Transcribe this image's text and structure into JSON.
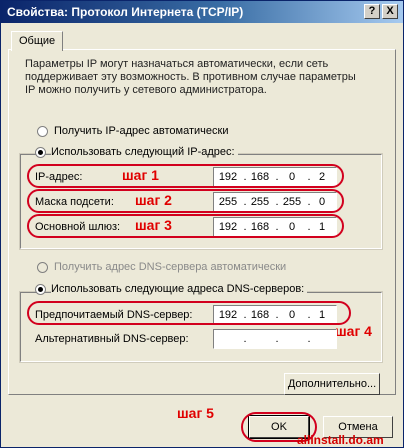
{
  "window": {
    "title": "Свойства: Протокол Интернета (TCP/IP)",
    "help_btn": "?",
    "close_btn": "X"
  },
  "tab": {
    "label": "Общие"
  },
  "description": "Параметры IP могут назначаться автоматически, если сеть поддерживает эту возможность. В противном случае параметры IP можно получить у сетевого администратора.",
  "ip": {
    "auto_label": "Получить IP-адрес автоматически",
    "manual_label": "Использовать следующий IP-адрес:",
    "selected": "manual",
    "fields": [
      {
        "label": "IP-адрес:",
        "octets": [
          "192",
          "168",
          "0",
          "2"
        ],
        "step": "шаг 1"
      },
      {
        "label": "Маска подсети:",
        "octets": [
          "255",
          "255",
          "255",
          "0"
        ],
        "step": "шаг 2"
      },
      {
        "label": "Основной шлюз:",
        "octets": [
          "192",
          "168",
          "0",
          "1"
        ],
        "step": "шаг 3"
      }
    ]
  },
  "dns": {
    "auto_label": "Получить адрес DNS-сервера автоматически",
    "manual_label": "Использовать следующие адреса DNS-серверов:",
    "selected": "manual",
    "preferred": {
      "label": "Предпочитаемый DNS-сервер:",
      "octets": [
        "192",
        "168",
        "0",
        "1"
      ],
      "step": "шаг 4"
    },
    "alternate": {
      "label": "Альтернативный DNS-сервер:",
      "octets": [
        "",
        "",
        "",
        ""
      ]
    }
  },
  "buttons": {
    "advanced": "Дополнительно...",
    "ok": "OK",
    "cancel": "Отмена",
    "ok_step": "шаг 5"
  },
  "watermark": "allinstall.do.am",
  "colors": {
    "annotation": "#e00000",
    "titlebar": "#0a246a",
    "dialog_bg": "#ece9d8"
  }
}
